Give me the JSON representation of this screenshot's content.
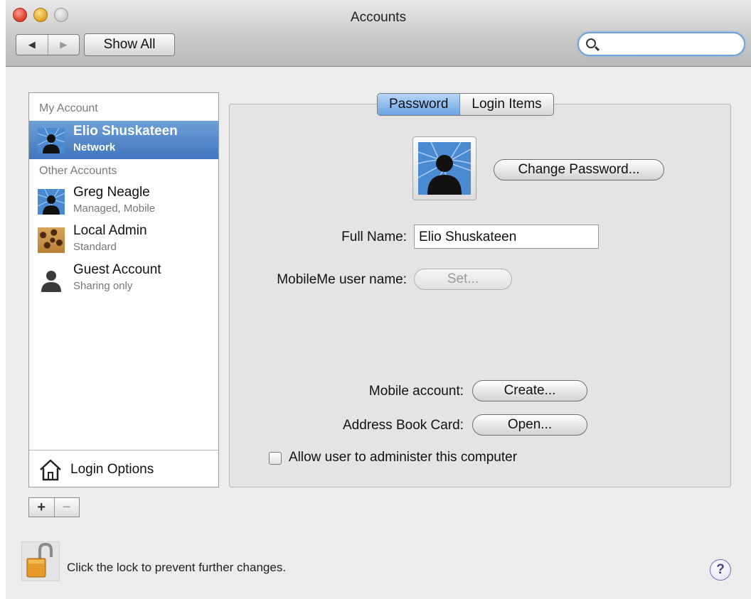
{
  "window": {
    "title": "Accounts"
  },
  "toolbar": {
    "back_glyph": "◀",
    "forward_glyph": "▶",
    "show_all_label": "Show All",
    "search": {
      "value": "",
      "placeholder": ""
    }
  },
  "sidebar": {
    "my_account_header": "My Account",
    "other_accounts_header": "Other Accounts",
    "my_account": {
      "name": "Elio Shuskateen",
      "subtitle": "Network",
      "icon": "network-globe-avatar-icon"
    },
    "other_accounts": [
      {
        "name": "Greg Neagle",
        "subtitle": "Managed, Mobile",
        "icon": "network-globe-avatar-icon"
      },
      {
        "name": "Local Admin",
        "subtitle": "Standard",
        "icon": "leopard-fur-avatar-icon"
      },
      {
        "name": "Guest Account",
        "subtitle": "Sharing only",
        "icon": "silhouette-avatar-icon"
      }
    ],
    "login_options_label": "Login Options",
    "add_label": "+",
    "remove_label": "−"
  },
  "tabs": [
    {
      "label": "Password",
      "active": true
    },
    {
      "label": "Login Items",
      "active": false
    }
  ],
  "password_pane": {
    "change_password_label": "Change Password...",
    "full_name_label": "Full Name:",
    "full_name_value": "Elio Shuskateen",
    "mobileme_label": "MobileMe user name:",
    "mobileme_button_label": "Set...",
    "mobile_account_label": "Mobile account:",
    "mobile_account_button_label": "Create...",
    "address_book_label": "Address Book Card:",
    "address_book_button_label": "Open...",
    "allow_admin_label": "Allow user to administer this computer",
    "allow_admin_checked": false
  },
  "footer": {
    "lock_text": "Click the lock to prevent further changes.",
    "help_label": "?"
  },
  "colors": {
    "selection_blue": "#3f76be",
    "tab_active_blue": "#6aa3e2",
    "search_focus": "#6fa3dc"
  }
}
